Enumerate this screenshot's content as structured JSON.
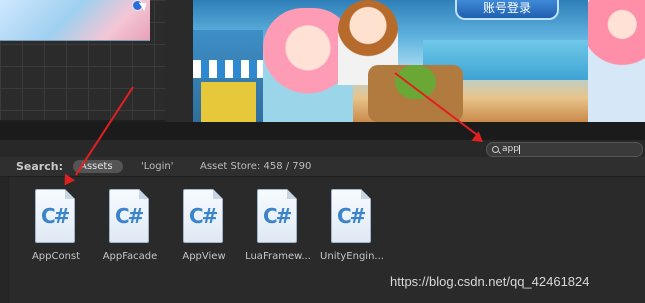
{
  "game_view": {
    "login_button_label": "账号登录"
  },
  "project": {
    "search": {
      "value": "app"
    },
    "filter": {
      "label": "Search:",
      "scope_assets": "Assets",
      "scope_login": "'Login'",
      "asset_store": "Asset Store: 458 / 790"
    },
    "assets": [
      {
        "name": "AppConst",
        "icon": "csharp-script-icon",
        "icon_text": "C#"
      },
      {
        "name": "AppFacade",
        "icon": "csharp-script-icon",
        "icon_text": "C#"
      },
      {
        "name": "AppView",
        "icon": "csharp-script-icon",
        "icon_text": "C#"
      },
      {
        "name": "LuaFramew...",
        "icon": "csharp-script-icon",
        "icon_text": "C#"
      },
      {
        "name": "UnityEngin...",
        "icon": "csharp-script-icon",
        "icon_text": "C#"
      }
    ]
  },
  "watermark": "https://blog.csdn.net/qq_42461824",
  "colors": {
    "annotation_arrow": "#e02020",
    "panel_background": "#2a2a2a",
    "csharp_blue": "#3b84c9"
  }
}
